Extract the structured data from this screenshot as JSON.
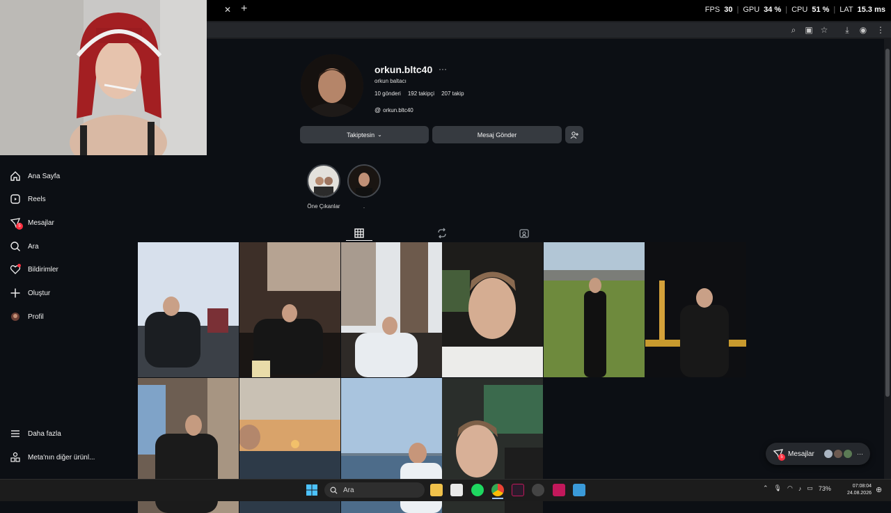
{
  "stats": {
    "fps_label": "FPS",
    "fps": "30",
    "gpu_label": "GPU",
    "gpu": "34 %",
    "cpu_label": "CPU",
    "cpu": "51 %",
    "lat_label": "LAT",
    "lat": "15.3 ms"
  },
  "sidebar": {
    "items": [
      {
        "label": "Ana Sayfa",
        "icon": "home-icon"
      },
      {
        "label": "Reels",
        "icon": "reels-icon"
      },
      {
        "label": "Mesajlar",
        "icon": "messages-icon",
        "badge": "5"
      },
      {
        "label": "Ara",
        "icon": "search-icon"
      },
      {
        "label": "Bildirimler",
        "icon": "heart-icon"
      },
      {
        "label": "Oluştur",
        "icon": "plus-icon"
      },
      {
        "label": "Profil",
        "icon": "avatar-icon"
      }
    ],
    "bottom": [
      {
        "label": "Daha fazla",
        "icon": "menu-icon"
      },
      {
        "label": "Meta'nın diğer ürünl...",
        "icon": "meta-apps-icon"
      }
    ]
  },
  "profile": {
    "username": "orkun.bltc40",
    "more": "···",
    "full_name": "orkun baltacı",
    "posts": "10 gönderi",
    "followers": "192 takipçi",
    "following": "207 takip",
    "threads": "orkun.bltc40",
    "follow_btn": "Takiptesin",
    "message_btn": "Mesaj Gönder"
  },
  "highlights": [
    {
      "label": "Öne Çıkanlar"
    },
    {
      "label": "."
    }
  ],
  "tabs": [
    "posts-grid-icon",
    "reposts-icon",
    "tagged-icon"
  ],
  "messages_pill": {
    "label": "Mesajlar",
    "badge": "5",
    "more": "···"
  },
  "taskbar": {
    "search_placeholder": "Ara"
  },
  "tray": {
    "battery": "73%",
    "time": "07:08:04",
    "date": "24.08.2026"
  },
  "colors": {
    "accent_red": "#ff3040",
    "bg": "#0c0f14",
    "button": "#363a40"
  }
}
